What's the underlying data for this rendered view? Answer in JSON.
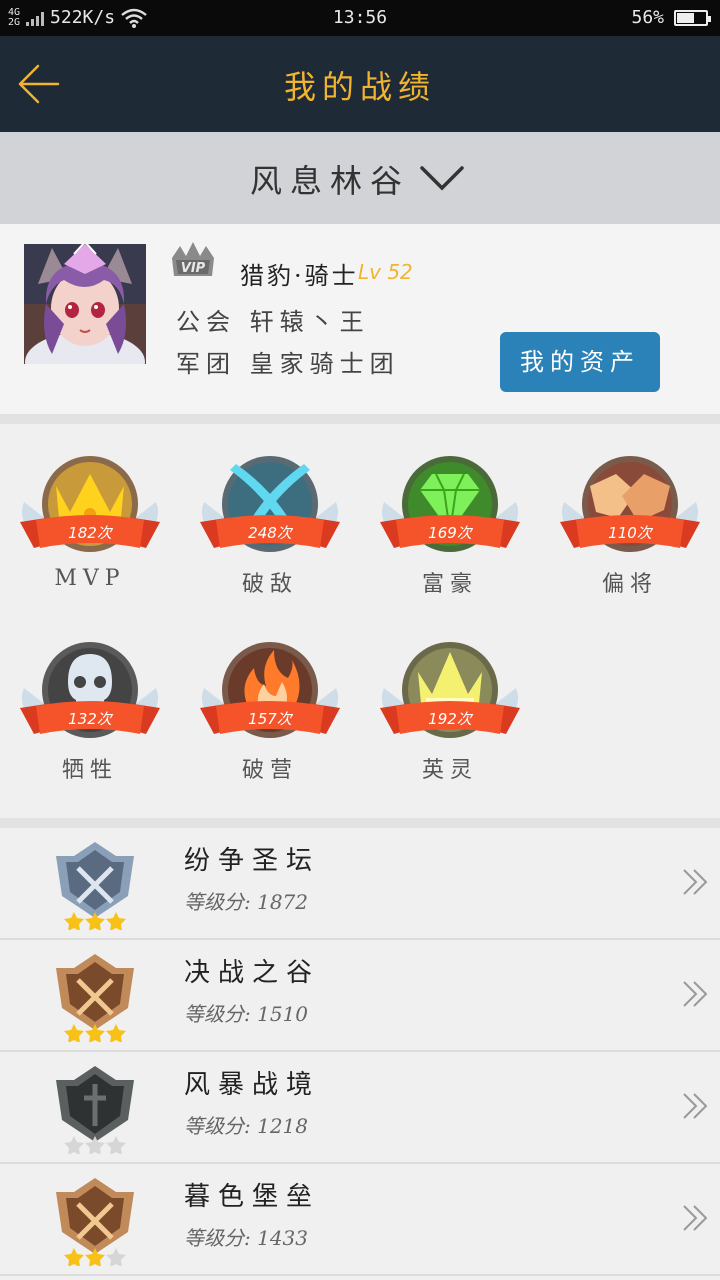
{
  "status_bar": {
    "network_top": "4G",
    "network_bottom": "2G",
    "speed": "522K/s",
    "time": "13:56",
    "battery": "56%",
    "icons": [
      "signal-icon",
      "wifi-icon",
      "battery-icon"
    ]
  },
  "nav": {
    "title": "我的战绩",
    "back_icon": "back-arrow-icon"
  },
  "server": {
    "name": "风息林谷",
    "icon": "chevron-down-icon"
  },
  "profile": {
    "name": "猎豹·骑士",
    "level": "Lv 52",
    "guild": "公会 轩辕丶王",
    "legion": "军团 皇家骑士团",
    "vip_badge": "VIP",
    "assets_button": "我的资产",
    "colors": {
      "level": "#f0b431",
      "button": "#2b82b8"
    }
  },
  "medals": [
    {
      "label": "MVP",
      "count": "182次",
      "icon": "crown-icon"
    },
    {
      "label": "破敌",
      "count": "248次",
      "icon": "crossed-swords-icon"
    },
    {
      "label": "富豪",
      "count": "169次",
      "icon": "diamond-icon"
    },
    {
      "label": "偏将",
      "count": "110次",
      "icon": "handshake-icon"
    },
    {
      "label": "牺牲",
      "count": "132次",
      "icon": "skull-icon"
    },
    {
      "label": "破营",
      "count": "157次",
      "icon": "flame-icon"
    },
    {
      "label": "英灵",
      "count": "192次",
      "icon": "ghost-crown-icon"
    }
  ],
  "maps": [
    {
      "name": "纷争圣坛",
      "score": "等级分: 1872",
      "stars": 3,
      "tier": "silver"
    },
    {
      "name": "决战之谷",
      "score": "等级分: 1510",
      "stars": 3,
      "tier": "bronze"
    },
    {
      "name": "风暴战境",
      "score": "等级分: 1218",
      "stars": 0,
      "tier": "iron"
    },
    {
      "name": "暮色堡垒",
      "score": "等级分: 1433",
      "stars": 2,
      "tier": "bronze"
    }
  ]
}
